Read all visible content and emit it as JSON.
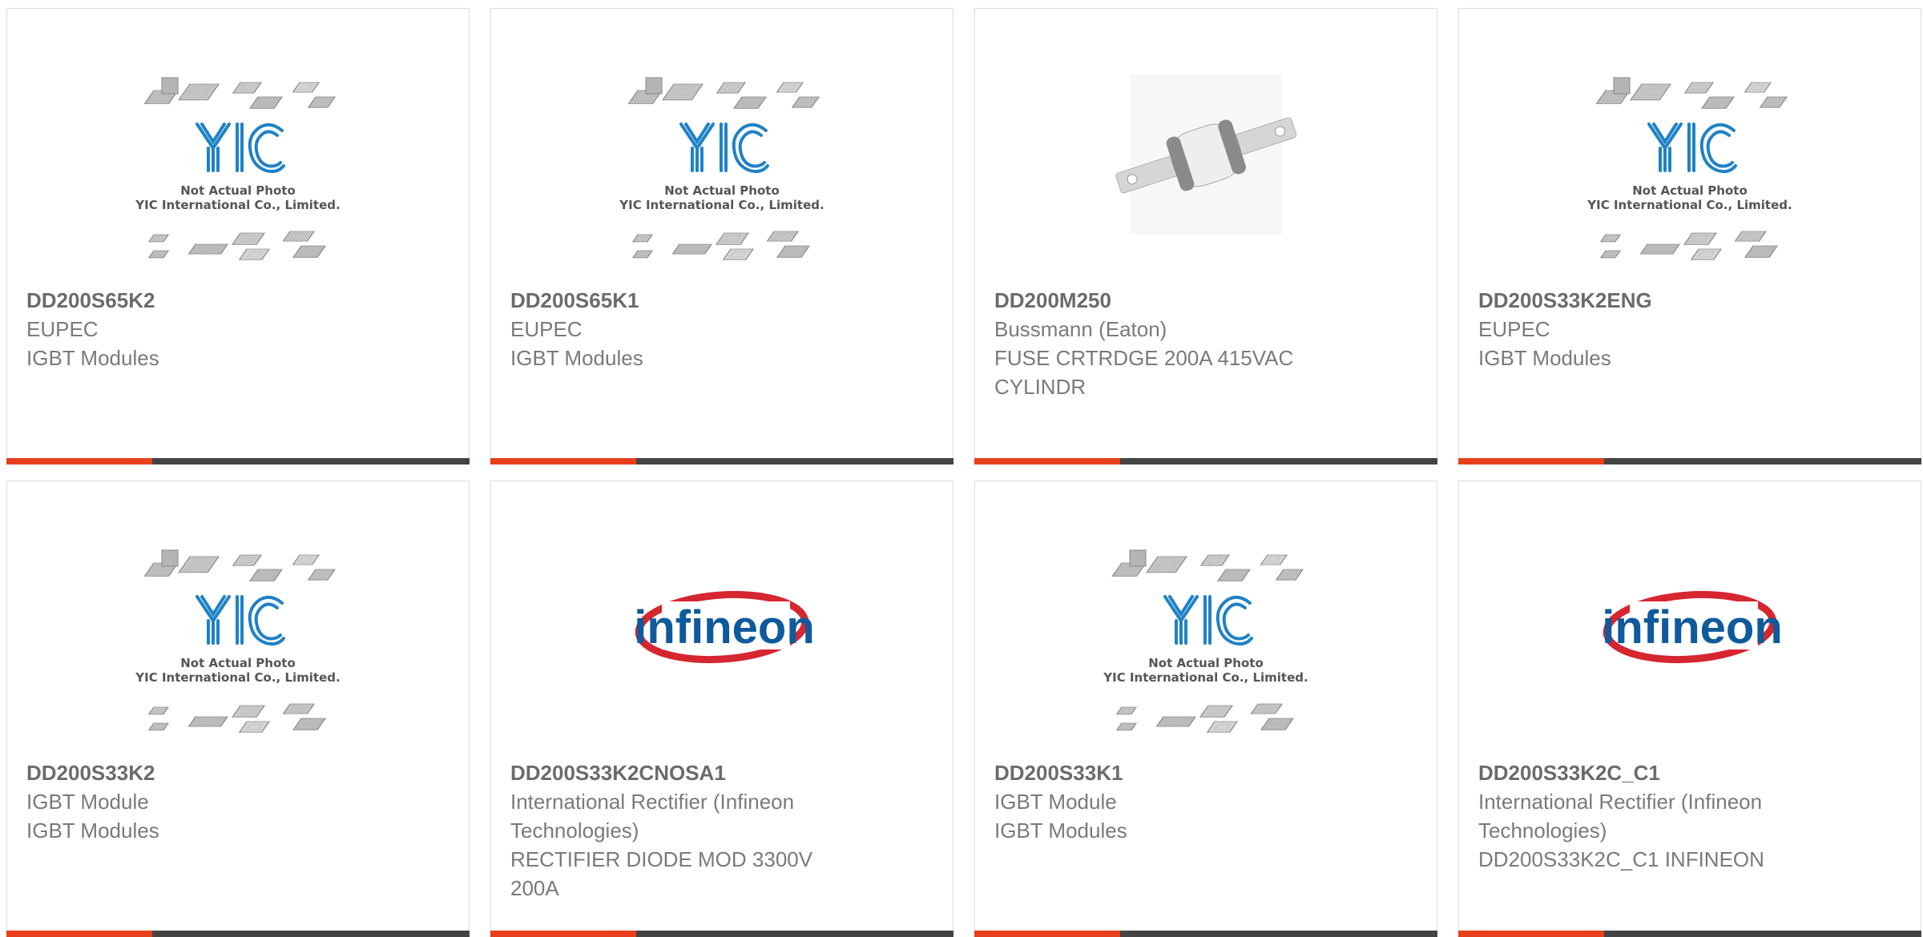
{
  "colors": {
    "accent": "#e8401c",
    "bar": "#444444",
    "yic_blue": "#1f82c6",
    "infineon_red": "#d62630",
    "infineon_blue": "#0f5a9c"
  },
  "products": [
    {
      "part": "DD200S65K2",
      "lines": [
        "EUPEC",
        "IGBT Modules"
      ],
      "image": "yic-placeholder"
    },
    {
      "part": "DD200S65K1",
      "lines": [
        "EUPEC",
        "IGBT Modules"
      ],
      "image": "yic-placeholder"
    },
    {
      "part": "DD200M250",
      "lines": [
        "Bussmann (Eaton)",
        "FUSE CRTRDGE 200A 415VAC CYLINDR"
      ],
      "image": "fuse-photo"
    },
    {
      "part": "DD200S33K2ENG",
      "lines": [
        "EUPEC",
        "IGBT Modules"
      ],
      "image": "yic-placeholder"
    },
    {
      "part": "DD200S33K2",
      "lines": [
        "IGBT Module",
        "IGBT Modules"
      ],
      "image": "yic-placeholder"
    },
    {
      "part": "DD200S33K2CNOSA1",
      "lines": [
        "International Rectifier (Infineon Technologies)",
        "RECTIFIER DIODE MOD 3300V 200A"
      ],
      "image": "infineon-logo"
    },
    {
      "part": "DD200S33K1",
      "lines": [
        "IGBT Module",
        "IGBT Modules"
      ],
      "image": "yic-placeholder"
    },
    {
      "part": "DD200S33K2C_C1",
      "lines": [
        "International Rectifier (Infineon Technologies)",
        "DD200S33K2C_C1 INFINEON"
      ],
      "image": "infineon-logo"
    }
  ],
  "placeholder": {
    "brand": "YIC",
    "note_line1": "Not Actual Photo",
    "note_line2": "YIC International Co., Limited."
  },
  "infineon_logo_text": "infineon"
}
